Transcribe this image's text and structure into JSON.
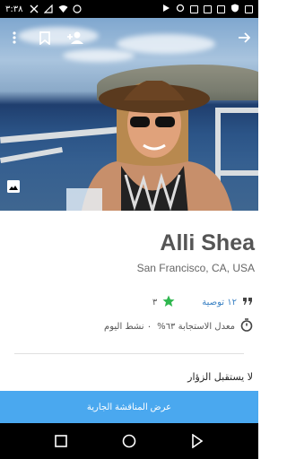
{
  "status_bar": {
    "time": "٣:٣٨"
  },
  "profile": {
    "name": "Alli Shea",
    "location": "San Francisco, CA, USA",
    "recommendations": "١٢ توصية",
    "star_count": "٣",
    "response_rate": "معدل الاستجابة ٦٣%",
    "activity": "٠ نشط اليوم",
    "visitors_status": "لا يستقبل الزؤار"
  },
  "cta": {
    "label": "عرض المناقشة الجارية"
  },
  "colors": {
    "accent": "#4aa8ef",
    "star": "#2fb74f",
    "link": "#3b82c4"
  },
  "icons": [
    "more-vert-icon",
    "bookmark-icon",
    "add-person-icon",
    "arrow-forward-icon",
    "gallery-icon",
    "quote-icon",
    "star-icon",
    "timer-icon",
    "back-icon",
    "home-icon",
    "recents-icon"
  ]
}
